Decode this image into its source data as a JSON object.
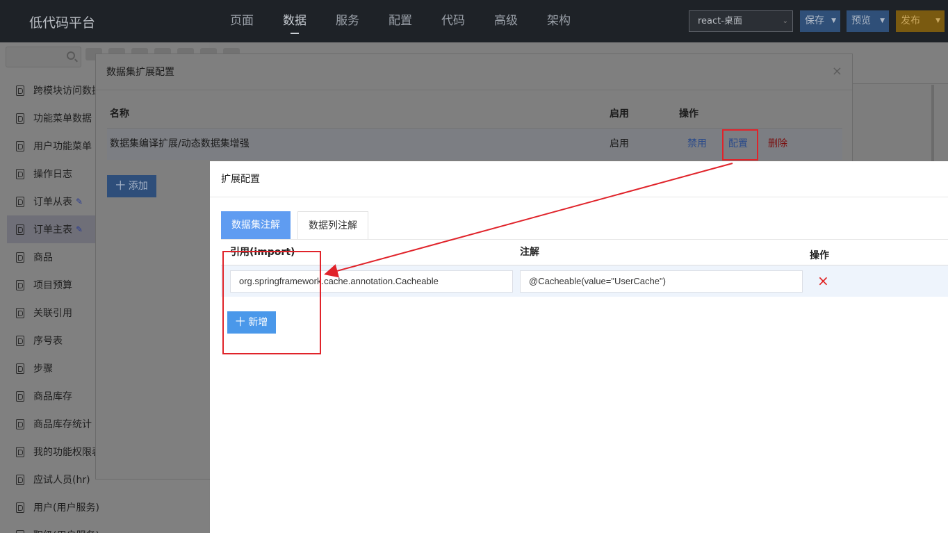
{
  "app": {
    "title": "低代码平台",
    "nav": [
      "页面",
      "数据",
      "服务",
      "配置",
      "代码",
      "高级",
      "架构"
    ],
    "active_nav": "数据",
    "env_select": "react-桌面",
    "buttons": {
      "save": "保存",
      "preview": "预览",
      "publish": "发布"
    }
  },
  "sidebar": {
    "items": [
      {
        "label": "跨模块访问数据"
      },
      {
        "label": "功能菜单数据"
      },
      {
        "label": "用户功能菜单"
      },
      {
        "label": "操作日志"
      },
      {
        "label": "订单从表",
        "edit": true
      },
      {
        "label": "订单主表",
        "edit": true,
        "active": true
      },
      {
        "label": "商品"
      },
      {
        "label": "项目预算"
      },
      {
        "label": "关联引用"
      },
      {
        "label": "序号表"
      },
      {
        "label": "步骤"
      },
      {
        "label": "商品库存"
      },
      {
        "label": "商品库存统计"
      },
      {
        "label": "我的功能权限表"
      },
      {
        "label": "应试人员(hr)"
      },
      {
        "label": "用户(用户服务)"
      },
      {
        "label": "职级(用户服务)"
      }
    ]
  },
  "dialog1": {
    "title": "数据集扩展配置",
    "close": "×",
    "columns": {
      "name": "名称",
      "enabled": "启用",
      "ops": "操作"
    },
    "row": {
      "name": "数据集编译扩展/动态数据集增强",
      "enabled": "启用",
      "disable": "禁用",
      "config": "配置",
      "delete": "删除"
    },
    "add": "十 添加"
  },
  "dialog2": {
    "title": "扩展配置",
    "tabs": [
      "数据集注解",
      "数据列注解"
    ],
    "columns": {
      "import": "引用(import)",
      "annotation": "注解",
      "ops": "操作"
    },
    "row": {
      "import": "org.springframework.cache.annotation.Cacheable",
      "annotation": "@Cacheable(value=\"UserCache\")",
      "delete_icon": "×"
    },
    "add": "十 新增"
  },
  "colors": {
    "highlight": "#e0232a",
    "primary": "#5f9cf1",
    "danger": "#e02020"
  }
}
